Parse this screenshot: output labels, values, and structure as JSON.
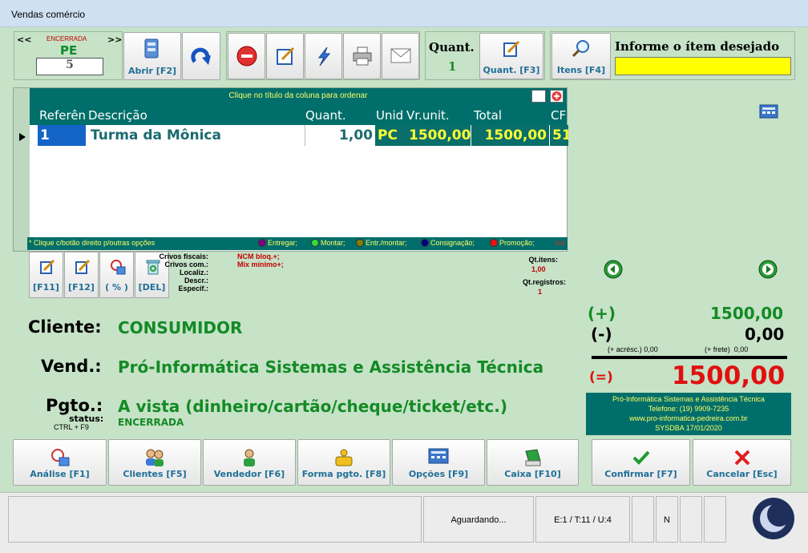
{
  "window": {
    "title": "Vendas comércio"
  },
  "record_nav": {
    "prev_label": "<<",
    "next_label": ">>",
    "status": "ENCERRADA",
    "code": "PE",
    "number": "5"
  },
  "toolbar": {
    "open_label": "Abrir [F2]",
    "quant_title": "Quant.",
    "quant_value": "1",
    "quant_button_label": "Quant. [F3]",
    "items_button_label": "Itens [F4]",
    "search_title": "Informe o ítem desejado",
    "search_value": ""
  },
  "grid": {
    "sort_hint": "Clique no título da coluna para ordenar",
    "columns": [
      "Referên",
      "Descrição",
      "Quant.",
      "Unid",
      "Vr.unit.",
      "Total",
      "CF"
    ],
    "rows": [
      {
        "ref": "1",
        "description": "Turma da Mônica",
        "quant": "1,00",
        "unit": "PC",
        "unit_price": "1500,00",
        "total": "1500,00",
        "cf": "51"
      }
    ]
  },
  "legend": {
    "hint": "* Clique c/botão direito p/outras opções",
    "items": [
      {
        "label": "Entregar;",
        "color": "#800080"
      },
      {
        "label": "Montar;",
        "color": "#33dd33"
      },
      {
        "label": "Entr./montar;",
        "color": "#808000"
      },
      {
        "label": "Consignação;",
        "color": "#000080"
      },
      {
        "label": "Promoção;",
        "color": "#ee1111"
      }
    ],
    "trailing": "Ind"
  },
  "item_buttons": [
    "[F11]",
    "[F12]",
    "( % )",
    "[DEL]"
  ],
  "crivos": {
    "fiscais_label": "Crivos fiscais:",
    "fiscais_value": "NCM bloq.+;",
    "com_label": "Crivos com.:",
    "com_value": "Mix mínimo+;",
    "localiz_label": "Localiz.:",
    "descr_label": "Descr.:",
    "especif_label": "Especif.:"
  },
  "counts": {
    "qt_itens_label": "Qt.itens:",
    "qt_itens_value": "1,00",
    "qt_registros_label": "Qt.registros:",
    "qt_registros_value": "1"
  },
  "sale": {
    "cliente_label": "Cliente:",
    "cliente_value": "CONSUMIDOR",
    "vend_label": "Vend.:",
    "vend_value": "Pró-Informática Sistemas e Assistência Técnica",
    "pgto_label": "Pgto.:",
    "pgto_value": "A vista (dinheiro/cartão/cheque/ticket/etc.)",
    "status_label": "status:",
    "status_shortcut": "CTRL + F9",
    "status_value": "ENCERRADA"
  },
  "totals": {
    "plus_sign": "(+)",
    "plus_value": "1500,00",
    "minus_sign": "(-)",
    "minus_value": "0,00",
    "acresc_label": "(+ acrésc.) 0,00",
    "frete_label": "(+ frete)  0,00",
    "eq_sign": "(=)",
    "total_value": "1500,00"
  },
  "company": {
    "line1": "Pró-Informática Sistemas e Assistência Técnica",
    "line2": "Telefone: (19) 9909-7235",
    "line3": "www.pro-informatica-pedreira.com.br",
    "line4": "SYSDBA 17/01/2020"
  },
  "bottom_buttons": {
    "analise": "Análise [F1]",
    "clientes": "Clientes [F5]",
    "vendedor": "Vendedor [F6]",
    "forma_pgto": "Forma pgto. [F8]",
    "opcoes": "Opções [F9]",
    "caixa": "Caixa [F10]",
    "confirmar": "Confirmar [F7]",
    "cancelar": "Cancelar [Esc]"
  },
  "statusbar": {
    "state": "Aguardando...",
    "counters": "E:1 / T:11 / U:4",
    "mode": "N"
  }
}
